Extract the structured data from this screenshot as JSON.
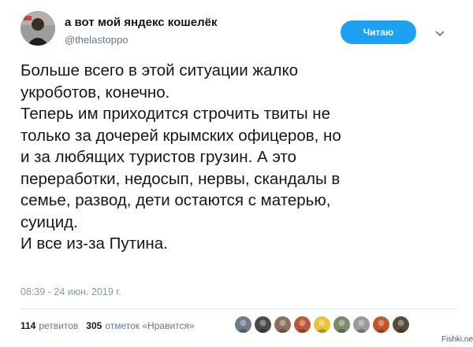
{
  "author": {
    "display_name": "а вот мой яндекс кошелёк",
    "handle": "@thelastoppo",
    "avatar_icon": "user-avatar-icon"
  },
  "follow_button": {
    "label": "Читаю",
    "color": "#1da1f2"
  },
  "tweet": {
    "lines": [
      "Больше всего в этой ситуации жалко",
      "укроботов, конечно.",
      "Теперь им приходится строчить твиты не",
      "только за дочерей крымских офицеров, но",
      "и за любящих туристов грузин. А это",
      "переработки, недосып, нервы, скандалы в",
      "семье, развод, дети остаются с матерью,",
      "суицид.",
      "И все из-за Путина."
    ],
    "timestamp": "08:39 - 24 июн. 2019 г."
  },
  "stats": {
    "retweets_count": "114",
    "retweets_label": "ретвитов",
    "likes_count": "305",
    "likes_label": "отметок «Нравится»"
  },
  "likers": [
    {
      "name": "liker-avatar-1",
      "color": "#6d7b8a"
    },
    {
      "name": "liker-avatar-2",
      "color": "#4a4a4a"
    },
    {
      "name": "liker-avatar-3",
      "color": "#8a6f5a"
    },
    {
      "name": "liker-avatar-4",
      "color": "#b85a3a"
    },
    {
      "name": "liker-avatar-5",
      "color": "#e8c23a"
    },
    {
      "name": "liker-avatar-6",
      "color": "#7a8a6a"
    },
    {
      "name": "liker-avatar-7",
      "color": "#9a9a9a"
    },
    {
      "name": "liker-avatar-8",
      "color": "#c0552e"
    },
    {
      "name": "liker-avatar-9",
      "color": "#5a4a3a"
    }
  ],
  "watermark": "Fishki.net"
}
